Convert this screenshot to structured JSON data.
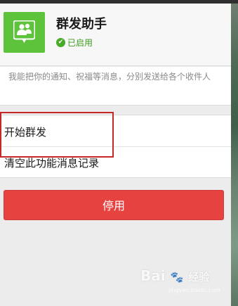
{
  "app": {
    "name": "群发助手",
    "status": "已启用",
    "icon": "group-people-icon",
    "accent_color": "#5cc33a"
  },
  "description": "我能把你的通知、祝福等消息，分别发送给各个收件人",
  "menu": {
    "items": [
      {
        "label": "开始群发"
      },
      {
        "label": "清空此功能消息记录"
      }
    ]
  },
  "actions": {
    "stop_label": "停用",
    "stop_color": "#e64340"
  },
  "watermark": {
    "brand": "Bai",
    "suffix": "经验",
    "url": "jingyan.baidu.com"
  }
}
